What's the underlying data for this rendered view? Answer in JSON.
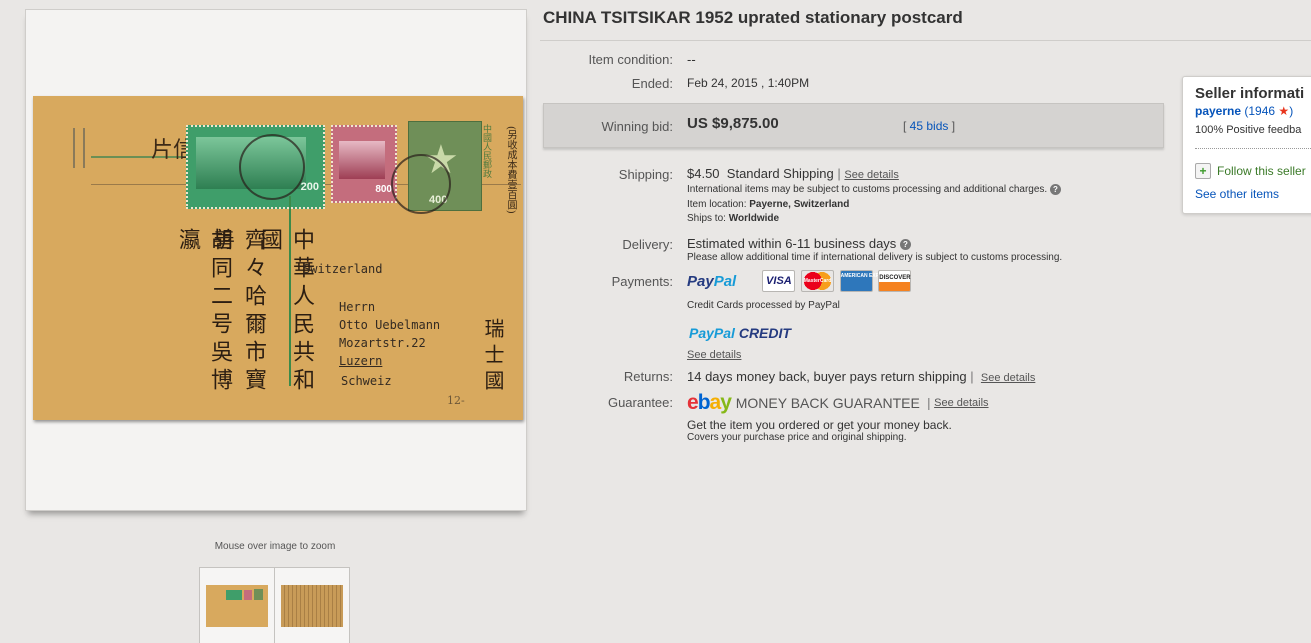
{
  "listing": {
    "title": "CHINA TSITSIKAR 1952 uprated stationary postcard"
  },
  "image": {
    "zoom_hint": "Mouse over image to zoom",
    "postcard": {
      "left_header": "片信",
      "stamp_values": [
        "200",
        "800",
        "400"
      ],
      "address_lines": [
        "Switzerland",
        "Herrn",
        "Otto Uebelmann",
        "Mozartstr.22",
        "Luzern",
        "Schweiz"
      ],
      "recipient_country_vertical": "瑞士國",
      "sender_col1": "中華人民共和國",
      "sender_col2": "齊々哈爾市寶善",
      "sender_col3": "胡同二号吳博瀛",
      "right_col": "(另收成本費壹百圓)",
      "stamp_corner_text": "中國人民郵政",
      "pencil_note": "12-"
    }
  },
  "details": {
    "condition": {
      "label": "Item condition:",
      "value": "--"
    },
    "ended": {
      "label": "Ended:",
      "value": "Feb 24, 2015 , 1:40PM"
    },
    "winning_bid": {
      "label": "Winning bid:",
      "value": "US $9,875.00",
      "bids": "45 bids"
    },
    "shipping": {
      "label": "Shipping:",
      "price": "$4.50",
      "method": "Standard Shipping",
      "see_details": "See details",
      "intl_note": "International items may be subject to customs processing and additional charges.",
      "location_label": "Item location:",
      "location": "Payerne, Switzerland",
      "ships_to_label": "Ships to:",
      "ships_to": "Worldwide"
    },
    "delivery": {
      "label": "Delivery:",
      "estimate": "Estimated within 6-11 business days",
      "note": "Please allow additional time if international delivery is subject to customs processing."
    },
    "payments": {
      "label": "Payments:",
      "paypal_word1": "Pay",
      "paypal_word2": "Pal",
      "cards": [
        "VISA",
        "MasterCard",
        "AMERICAN EXPRESS",
        "DISCOVER"
      ],
      "card_note": "Credit Cards processed by PayPal",
      "credit_word1": "PayPal",
      "credit_word2": "CREDIT",
      "credit_see_details": "See details"
    },
    "returns": {
      "label": "Returns:",
      "value": "14 days money back, buyer pays return shipping",
      "see_details": "See details"
    },
    "guarantee": {
      "label": "Guarantee:",
      "logo": [
        "e",
        "b",
        "a",
        "y"
      ],
      "logo_text": "MONEY BACK GUARANTEE",
      "see_details": "See details",
      "line1": "Get the item you ordered or get your money back.",
      "line2": "Covers your purchase price and original shipping."
    }
  },
  "seller": {
    "heading": "Seller informati",
    "name": "payerne",
    "feedback_count": "1946",
    "feedback_pct": "100% Positive feedba",
    "follow": "Follow this seller",
    "see_other": "See other items"
  },
  "colors": {
    "link_blue": "#0654ba",
    "ebay_red": "#e53238",
    "ebay_blue": "#0064d2",
    "ebay_yellow": "#f5af02",
    "ebay_green": "#86b817",
    "paypal_dark": "#253b80",
    "paypal_light": "#179bd7",
    "postcard": "#d8a95e",
    "stamp_green": "#3f9e6a"
  }
}
